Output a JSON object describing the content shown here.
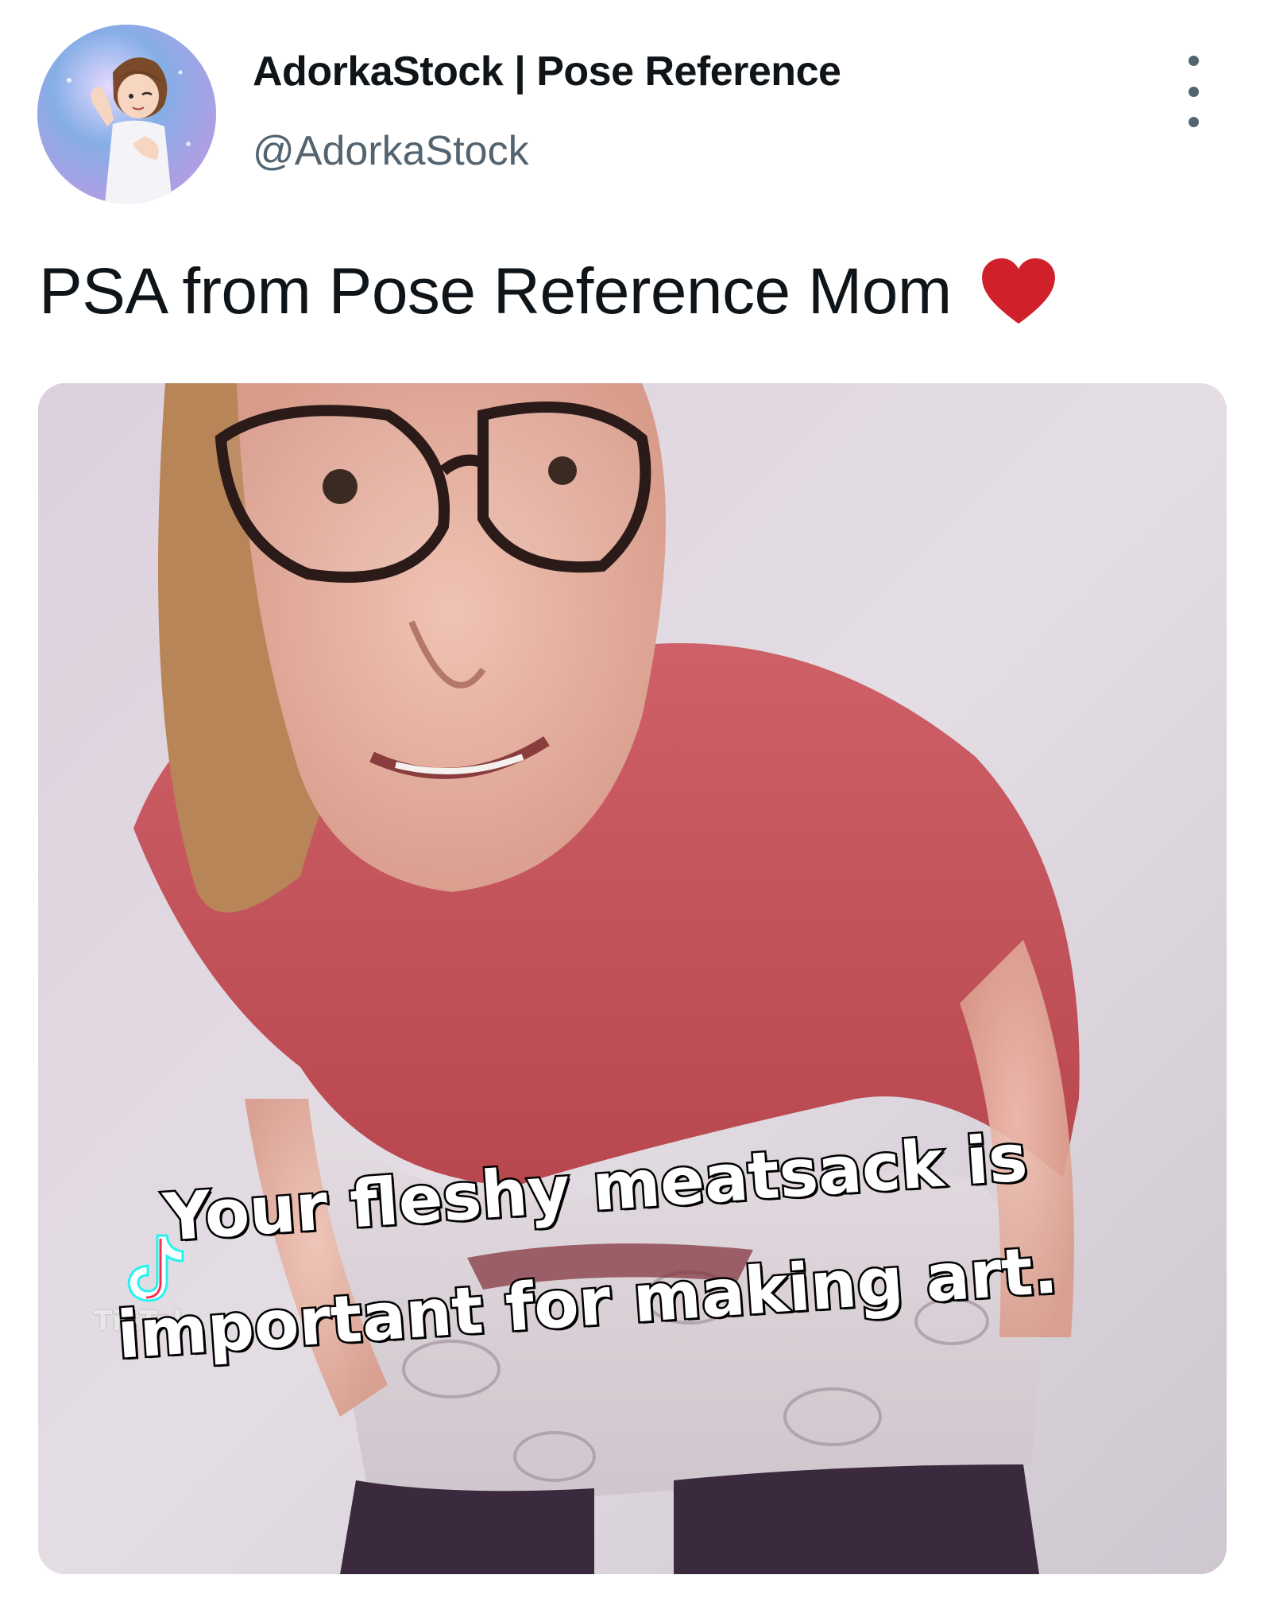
{
  "author": {
    "name": "AdorkaStock | Pose Reference",
    "handle": "@AdorkaStock"
  },
  "tweet": {
    "text": "PSA from Pose Reference Mom",
    "emoji": "heart-icon"
  },
  "media": {
    "caption_line1": "Your fleshy meatsack is",
    "caption_line2": "important for making art.",
    "watermark": "TikTok"
  },
  "colors": {
    "heart": "#d0202a",
    "shirt": "#c9575f",
    "text_primary": "#0f1419",
    "text_secondary": "#536471"
  }
}
